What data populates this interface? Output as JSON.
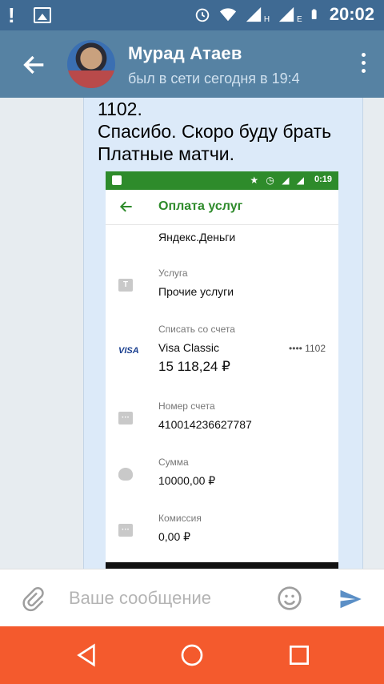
{
  "status_bar": {
    "time": "20:02",
    "net_a": "H",
    "net_b": "E"
  },
  "header": {
    "name": "Мурад Атаев",
    "status": "был в сети сегодня в 19:4"
  },
  "message": {
    "lines": [
      "1102.",
      "Спасибо. Скоро буду брать",
      "Платные матчи."
    ]
  },
  "screenshot": {
    "time": "0:19",
    "title": "Оплата услуг",
    "recipient": "Яндекс.Деньги",
    "service_label": "Услуга",
    "service_icon_letter": "T",
    "service_value": "Прочие услуги",
    "account_label": "Списать со счета",
    "card_brand": "VISA",
    "card_name": "Visa Classic",
    "card_mask": "•••• 1102",
    "balance": "15 118,24 ₽",
    "number_label": "Номер счета",
    "number_value": "410014236627787",
    "sum_label": "Сумма",
    "sum_value": "10000,00 ₽",
    "fee_label": "Комиссия",
    "fee_value": "0,00 ₽"
  },
  "input": {
    "placeholder": "Ваше сообщение"
  },
  "colors": {
    "header": "#5682a3",
    "statusbar": "#3f6a93",
    "navbar": "#f45a2d",
    "accent": "#2e8b2b"
  }
}
